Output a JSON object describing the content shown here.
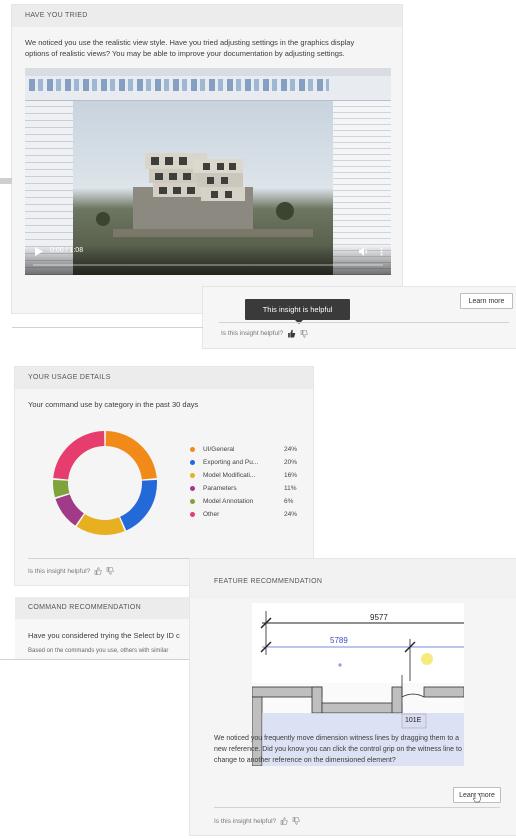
{
  "have_you_tried": {
    "title": "HAVE YOU TRIED",
    "text_line1": "We noticed you use the realistic view style. Have you tried adjusting settings in the graphics display",
    "text_line2": "options of realistic views? You may be able to improve your documentation by adjusting settings.",
    "video": {
      "time": "0:00 / 1:08",
      "progress": 0
    },
    "tooltip": "This insight is helpful",
    "learn_more": "Learn more",
    "helpful_question": "Is this insight helpful?"
  },
  "usage_details": {
    "title": "YOUR USAGE DETAILS",
    "subtitle": "Your command use by category in the past 30 days",
    "helpful_question": "Is this insight helpful?",
    "chart_data": {
      "type": "pie",
      "categories": [
        "UI/General",
        "Exporting and Pu...",
        "Model Modificati...",
        "Parameters",
        "Model Annotation",
        "Other"
      ],
      "values": [
        24,
        20,
        16,
        11,
        6,
        24
      ],
      "colors": [
        "#f28a1a",
        "#2469d8",
        "#e6b020",
        "#a23a8a",
        "#7fa33b",
        "#e63c6e"
      ],
      "value_labels": [
        "24%",
        "20%",
        "16%",
        "11%",
        "6%",
        "24%"
      ]
    }
  },
  "command_recommendation": {
    "title": "COMMAND RECOMMENDATION",
    "text": "Have you considered trying the Select by ID c",
    "subtext": "Based on the commands you use, others with similar"
  },
  "feature_recommendation": {
    "title": "FEATURE RECOMMENDATION",
    "dim_top": "9577",
    "dim_mid": "5789",
    "room_tag": "101E",
    "text_line1": "We noticed you frequently move dimension witness lines by dragging them to a",
    "text_line2": "new reference. Did you know you can click the control grip on the witness line to",
    "text_line3": "change to another reference on the dimensioned element?",
    "learn_more": "Learn more",
    "helpful_question": "Is this insight helpful?"
  },
  "icons": [
    "thumbs-up-icon",
    "thumbs-down-icon",
    "play-icon",
    "volume-icon",
    "more-vertical-icon",
    "cursor-hand-icon"
  ]
}
